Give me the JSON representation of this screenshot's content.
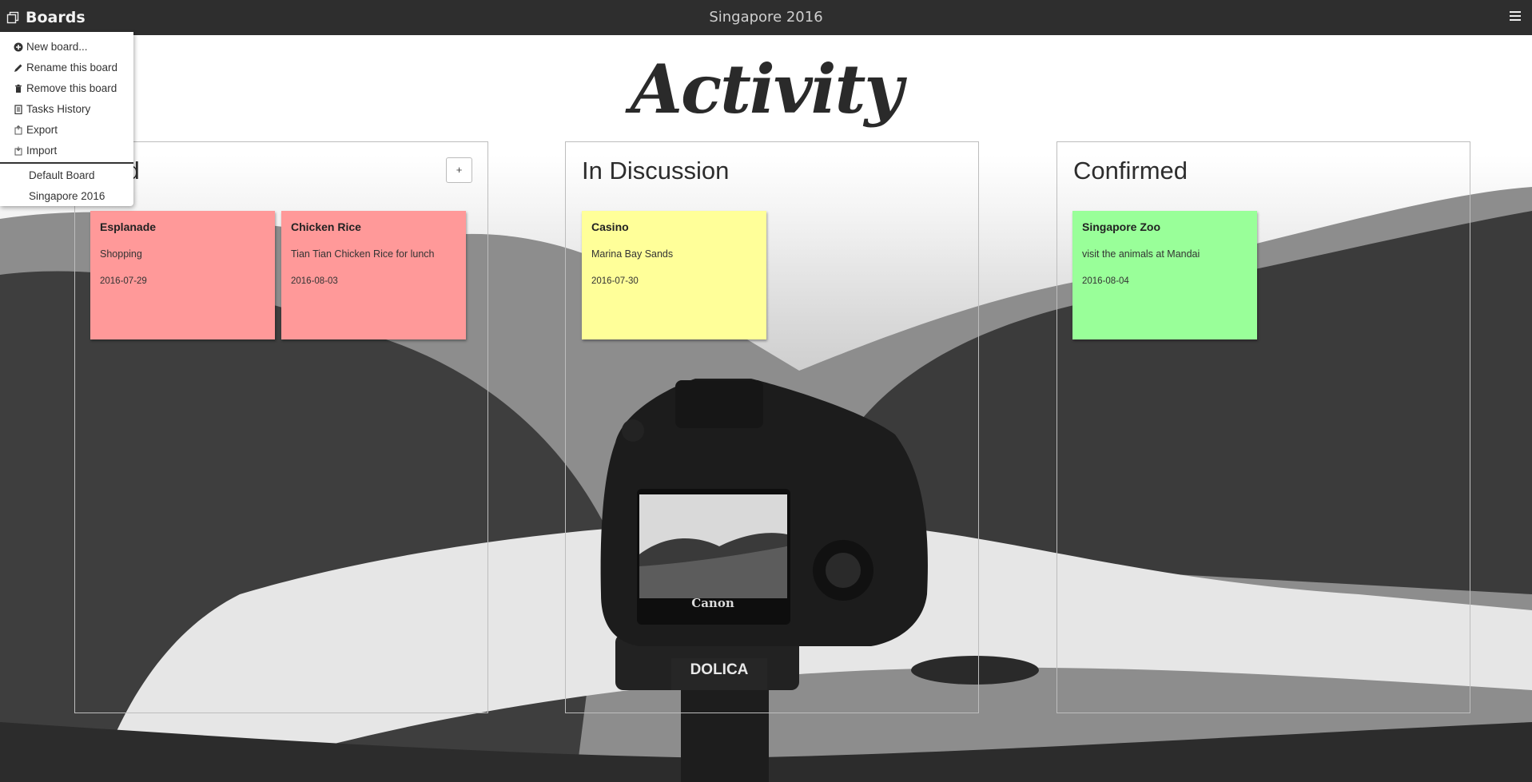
{
  "topbar": {
    "brand_label": "Boards",
    "board_title": "Singapore 2016"
  },
  "menu": {
    "items": [
      {
        "label": "New board...",
        "icon": "plus-circle-icon"
      },
      {
        "label": "Rename this board",
        "icon": "pencil-icon"
      },
      {
        "label": "Remove this board",
        "icon": "trash-icon"
      },
      {
        "label": "Tasks History",
        "icon": "history-icon"
      },
      {
        "label": "Export",
        "icon": "export-icon"
      },
      {
        "label": "Import",
        "icon": "import-icon"
      }
    ],
    "boards": [
      "Default Board",
      "Singapore 2016"
    ]
  },
  "heading": "Activity",
  "columns": [
    {
      "title": "Proposed",
      "add_label": "+",
      "cards": [
        {
          "title": "Esplanade",
          "description": "Shopping",
          "date": "2016-07-29",
          "color": "#ff9999"
        },
        {
          "title": "Chicken Rice",
          "description": "Tian Tian Chicken Rice for lunch",
          "date": "2016-08-03",
          "color": "#ff9999"
        }
      ]
    },
    {
      "title": "In Discussion",
      "cards": [
        {
          "title": "Casino",
          "description": "Marina Bay Sands",
          "date": "2016-07-30",
          "color": "#ffff99"
        }
      ]
    },
    {
      "title": "Confirmed",
      "cards": [
        {
          "title": "Singapore Zoo",
          "description": "visit the animals at Mandai",
          "date": "2016-08-04",
          "color": "#99ff99"
        }
      ]
    }
  ],
  "background": {
    "camera_brand": "Canon",
    "tripod_brand": "DOLICA"
  }
}
